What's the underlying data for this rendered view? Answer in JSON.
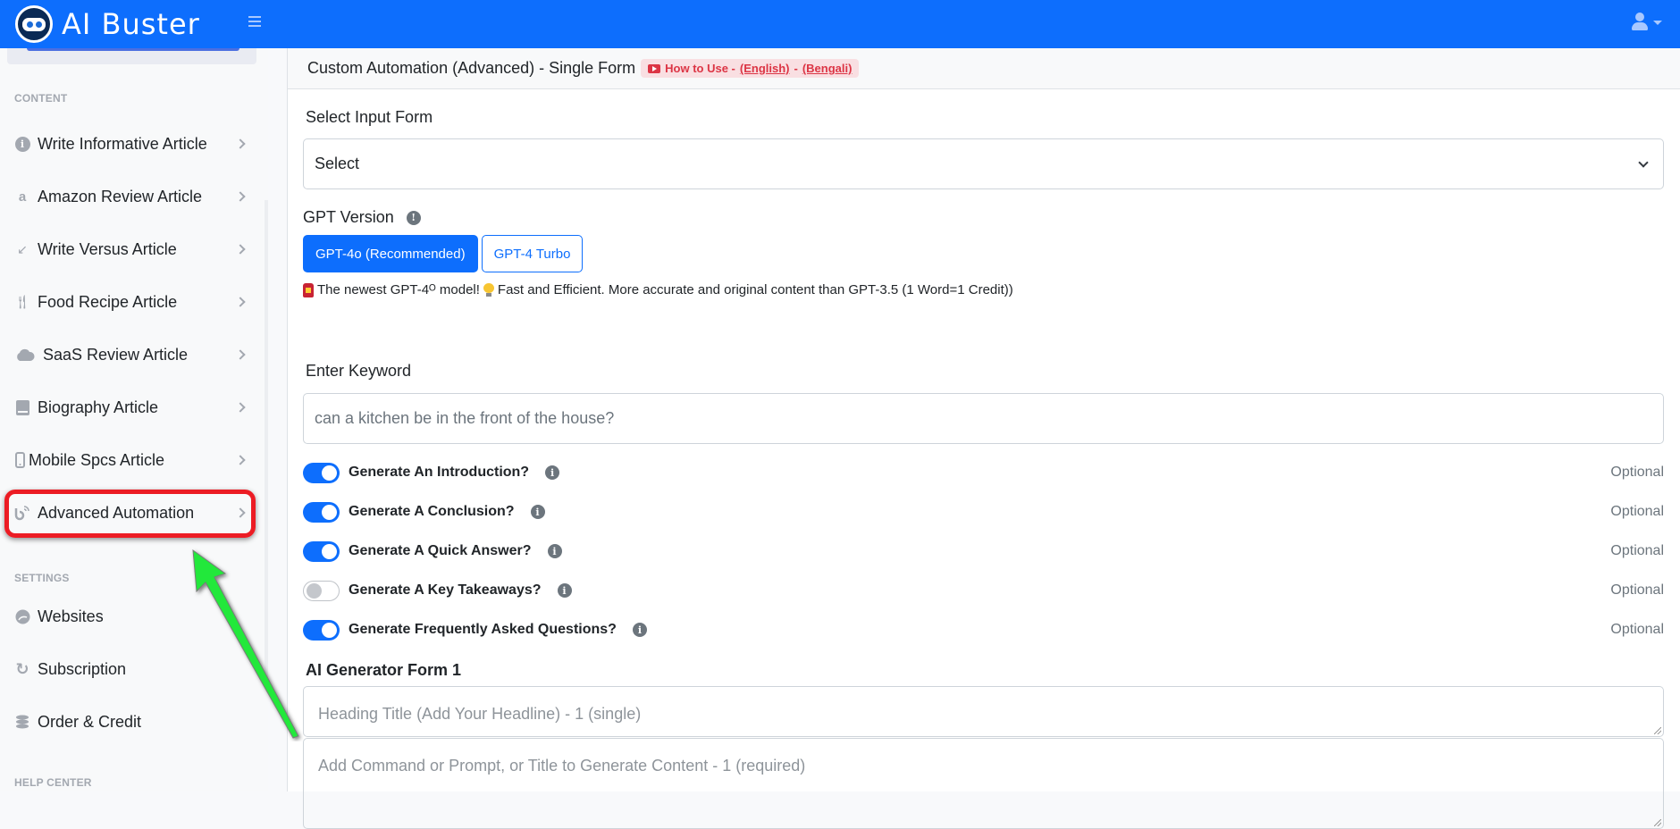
{
  "topbar": {
    "brand": "AI Buster",
    "menu_icon": "hamburger-icon",
    "user_icon": "user-icon"
  },
  "sidebar": {
    "sections": [
      {
        "label": "CONTENT",
        "items": [
          {
            "label": "Write Informative Article",
            "icon": "info-circle-icon"
          },
          {
            "label": "Amazon Review Article",
            "icon": "amazon-icon"
          },
          {
            "label": "Write Versus Article",
            "icon": "compress-arrows-icon"
          },
          {
            "label": "Food Recipe Article",
            "icon": "utensils-icon"
          },
          {
            "label": "SaaS Review Article",
            "icon": "cloud-icon"
          },
          {
            "label": "Biography Article",
            "icon": "book-icon"
          },
          {
            "label": "Mobile Spcs Article",
            "icon": "mobile-icon"
          },
          {
            "label": "Advanced Automation",
            "icon": "feed-icon",
            "highlighted": true
          }
        ]
      },
      {
        "label": "SETTINGS",
        "items": [
          {
            "label": "Websites",
            "icon": "globe-icon"
          },
          {
            "label": "Subscription",
            "icon": "sync-icon"
          },
          {
            "label": "Order & Credit",
            "icon": "coins-icon"
          }
        ]
      },
      {
        "label": "HELP CENTER",
        "items": []
      }
    ]
  },
  "annotation": {
    "highlight_color": "#ec1c24",
    "arrow_color": "#22e83a"
  },
  "main": {
    "title": "Custom Automation (Advanced) - Single Form",
    "howto": {
      "prefix": "How to Use -",
      "english": "(English)",
      "separator": "-",
      "bengali": "(Bengali)"
    },
    "select_input_form": {
      "label": "Select Input Form",
      "value": "Select"
    },
    "gpt_version": {
      "label": "GPT Version",
      "options": [
        {
          "label": "GPT-4o (Recommended)",
          "selected": true
        },
        {
          "label": "GPT-4 Turbo",
          "selected": false
        }
      ],
      "note": "The newest GPT-4ᴼ model!",
      "note2": "Fast and Efficient. More accurate and original content than GPT-3.5 (1 Word=1 Credit))"
    },
    "keyword": {
      "label": "Enter Keyword",
      "value": "can a kitchen be in the front of the house?"
    },
    "toggles": [
      {
        "label": "Generate An Introduction?",
        "on": true,
        "tag": "Optional"
      },
      {
        "label": "Generate A Conclusion?",
        "on": true,
        "tag": "Optional"
      },
      {
        "label": "Generate A Quick Answer?",
        "on": true,
        "tag": "Optional"
      },
      {
        "label": "Generate A Key Takeaways?",
        "on": false,
        "tag": "Optional"
      },
      {
        "label": "Generate Frequently Asked Questions?",
        "on": true,
        "tag": "Optional"
      }
    ],
    "generator_form": {
      "title": "AI Generator Form 1",
      "heading_placeholder": "Heading Title (Add Your Headline) - 1 (single)",
      "prompt_placeholder": "Add Command or Prompt, or Title to Generate Content - 1 (required)"
    }
  }
}
